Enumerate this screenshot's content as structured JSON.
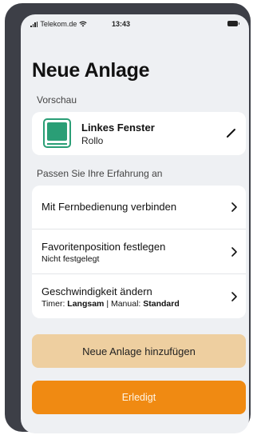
{
  "status_bar": {
    "carrier": "Telekom.de",
    "time": "13:43"
  },
  "page": {
    "title": "Neue Anlage"
  },
  "preview": {
    "section_label": "Vorschau",
    "name": "Linkes Fenster",
    "type": "Rollo",
    "icon": "window-blind-icon",
    "accent": "#2a9e76"
  },
  "customize": {
    "section_label": "Passen Sie Ihre Erfahrung an",
    "remote": {
      "label": "Mit Fernbedienung verbinden"
    },
    "favorite": {
      "label": "Favoritenposition festlegen",
      "value": "Nicht festgelegt"
    },
    "speed": {
      "label": "Geschwindigkeit ändern",
      "timer_prefix": "Timer:",
      "timer_value": "Langsam",
      "separator": "|",
      "manual_prefix": "Manual:",
      "manual_value": "Standard"
    }
  },
  "actions": {
    "add_label": "Neue Anlage hinzufügen",
    "done_label": "Erledigt",
    "add_color": "#eecfa0",
    "done_color": "#f08a12"
  }
}
